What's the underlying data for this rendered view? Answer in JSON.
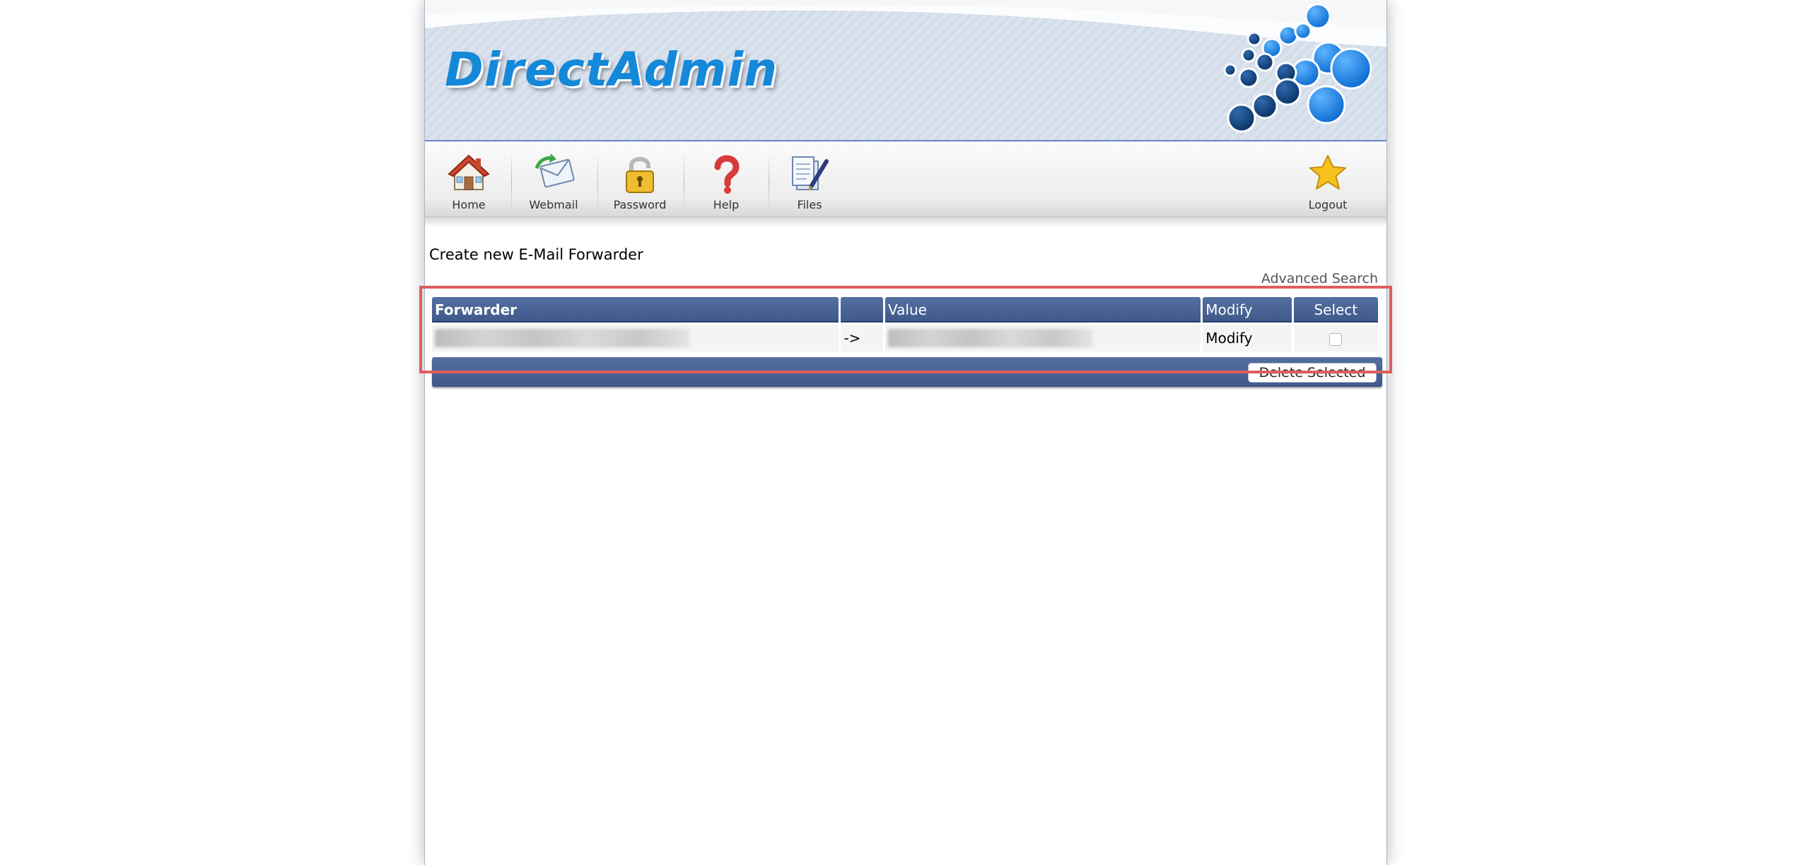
{
  "app": {
    "logo_text": "DirectAdmin"
  },
  "nav": {
    "items": [
      {
        "label": "Home",
        "icon": "home-icon"
      },
      {
        "label": "Webmail",
        "icon": "webmail-icon"
      },
      {
        "label": "Password",
        "icon": "lock-icon"
      },
      {
        "label": "Help",
        "icon": "help-icon"
      },
      {
        "label": "Files",
        "icon": "files-icon"
      },
      {
        "label": "Logout",
        "icon": "star-icon"
      }
    ]
  },
  "content": {
    "title": "Create new E-Mail Forwarder",
    "advanced_search": "Advanced Search"
  },
  "table": {
    "headers": {
      "forwarder": "Forwarder",
      "arrow": "",
      "value": "Value",
      "modify": "Modify",
      "select": "Select"
    },
    "rows": [
      {
        "arrow": "->",
        "modify": "Modify"
      }
    ],
    "delete_button": "Delete Selected"
  },
  "colors": {
    "header_blue": "#475f93",
    "logo_blue": "#1488d9",
    "highlight_red": "#e05d5d"
  }
}
